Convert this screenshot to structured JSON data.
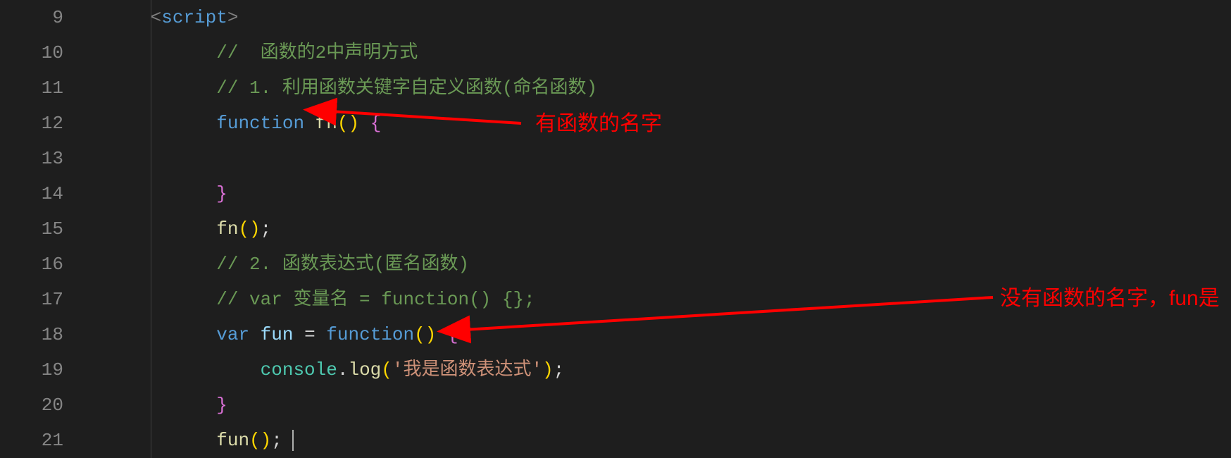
{
  "lineNumbers": [
    "9",
    "10",
    "11",
    "12",
    "13",
    "14",
    "15",
    "16",
    "17",
    "18",
    "19",
    "20",
    "21"
  ],
  "code": {
    "l9": {
      "tagOpen": "<",
      "tag": "script",
      "tagClose": ">"
    },
    "l10": {
      "comment": "//  函数的2中声明方式"
    },
    "l11": {
      "comment": "// 1. 利用函数关键字自定义函数(命名函数)"
    },
    "l12": {
      "kw": "function",
      "sp": " ",
      "name": "fn",
      "p": "()",
      "sp2": " ",
      "brace": "{"
    },
    "l13": {
      "blank": ""
    },
    "l14": {
      "brace": "}"
    },
    "l15": {
      "name": "fn",
      "p": "()",
      "semi": ";"
    },
    "l16": {
      "comment": "// 2. 函数表达式(匿名函数)"
    },
    "l17": {
      "comment": "// var 变量名 = function() {};"
    },
    "l18": {
      "kw": "var",
      "sp": " ",
      "v": "fun",
      "sp2": " ",
      "eq": "=",
      "sp3": " ",
      "kw2": "function",
      "p": "()",
      "sp4": " ",
      "brace": "{"
    },
    "l19": {
      "obj": "console",
      "dot": ".",
      "m": "log",
      "p1": "(",
      "str": "'我是函数表达式'",
      "p2": ")",
      "semi": ";"
    },
    "l20": {
      "brace": "}"
    },
    "l21": {
      "name": "fun",
      "p": "()",
      "semi": ";"
    }
  },
  "annotations": {
    "a1": "有函数的名字",
    "a2": "没有函数的名字，fun是"
  }
}
